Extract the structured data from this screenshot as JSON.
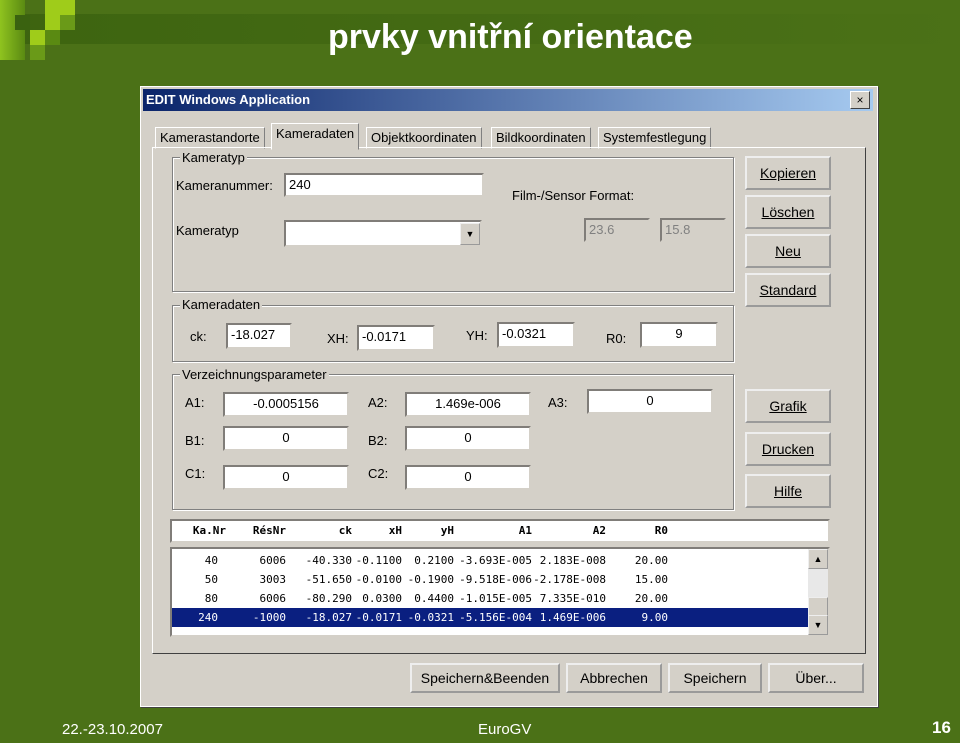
{
  "slide": {
    "title": "prvky vnitřní orientace",
    "date": "22.-23.10.2007",
    "center": "EuroGV",
    "page": "16"
  },
  "window": {
    "title": "EDIT Windows Application",
    "close": "×"
  },
  "tabs": [
    "Kamerastandorte",
    "Kameradaten",
    "Objektkoordinaten",
    "Bildkoordinaten",
    "Systemfestlegung"
  ],
  "kameratyp": {
    "group": "Kameratyp",
    "nummer_label": "Kameranummer:",
    "nummer": "240",
    "typ_label": "Kameratyp",
    "typ": "",
    "format_label": "Film-/Sensor Format:",
    "fx": "23.6",
    "fy": "15.8"
  },
  "kameradaten": {
    "group": "Kameradaten",
    "ck_label": "ck:",
    "ck": "-18.027",
    "xh_label": "XH:",
    "xh": "-0.0171",
    "yh_label": "YH:",
    "yh": "-0.0321",
    "r0_label": "R0:",
    "r0": "9"
  },
  "verz": {
    "group": "Verzeichnungsparameter",
    "a1_label": "A1:",
    "a1": "-0.0005156",
    "a2_label": "A2:",
    "a2": "1.469e-006",
    "a3_label": "A3:",
    "a3": "0",
    "b1_label": "B1:",
    "b1": "0",
    "b2_label": "B2:",
    "b2": "0",
    "c1_label": "C1:",
    "c1": "0",
    "c2_label": "C2:",
    "c2": "0"
  },
  "side_buttons": [
    "Kopieren",
    "Löschen",
    "Neu",
    "Standard",
    "Grafik",
    "Drucken",
    "Hilfe"
  ],
  "table": {
    "columns": [
      "Ka.Nr",
      "RésNr",
      "ck",
      "xH",
      "yH",
      "A1",
      "A2",
      "R0"
    ],
    "rows": [
      [
        "40",
        "6006",
        "-40.330",
        "-0.1100",
        "0.2100",
        "-3.693E-005",
        "2.183E-008",
        "20.00"
      ],
      [
        "50",
        "3003",
        "-51.650",
        "-0.0100",
        "-0.1900",
        "-9.518E-006",
        "-2.178E-008",
        "15.00"
      ],
      [
        "80",
        "6006",
        "-80.290",
        "0.0300",
        "0.4400",
        "-1.015E-005",
        "7.335E-010",
        "20.00"
      ],
      [
        "240",
        "-1000",
        "-18.027",
        "-0.0171",
        "-0.0321",
        "-5.156E-004",
        "1.469E-006",
        "9.00"
      ]
    ],
    "selected_row": 3
  },
  "bottom_buttons": [
    "Speichern&Beenden",
    "Abbrechen",
    "Speichern",
    "Über..."
  ]
}
